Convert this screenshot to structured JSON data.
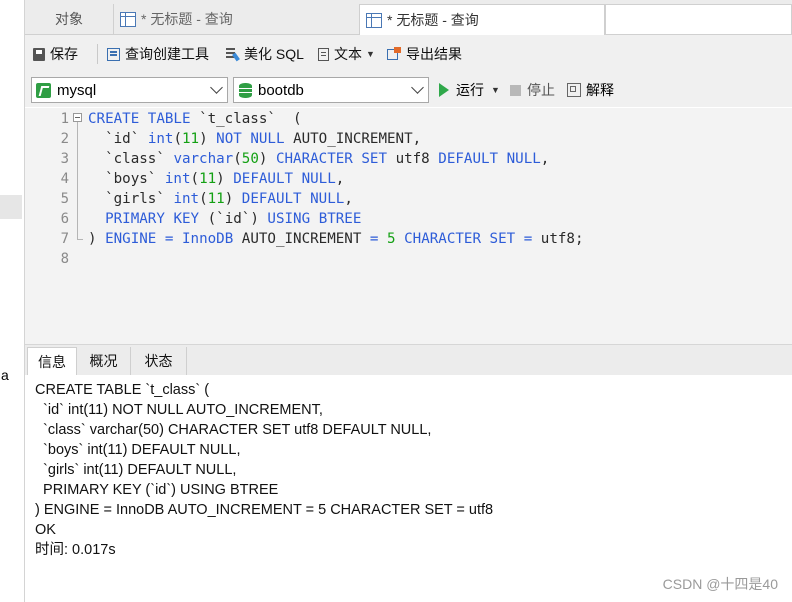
{
  "tabs": [
    {
      "label": "对象",
      "icon": "none"
    },
    {
      "label": "* 无标题 - 查询",
      "icon": "table-query-icon"
    },
    {
      "label": "* 无标题 - 查询",
      "icon": "table-query-icon",
      "active": true
    }
  ],
  "toolbar": {
    "save": "保存",
    "query_builder": "查询创建工具",
    "beautify": "美化 SQL",
    "text": "文本",
    "export": "导出结果"
  },
  "connection": {
    "server": "mysql",
    "database": "bootdb",
    "run": "运行",
    "stop": "停止",
    "explain": "解释"
  },
  "editor": {
    "line_numbers": [
      "1",
      "2",
      "3",
      "4",
      "5",
      "6",
      "7",
      "8"
    ]
  },
  "info_tabs": [
    "信息",
    "概况",
    "状态"
  ],
  "output": {
    "lines": [
      "CREATE TABLE `t_class` (",
      "  `id` int(11) NOT NULL AUTO_INCREMENT,",
      "  `class` varchar(50) CHARACTER SET utf8 DEFAULT NULL,",
      "  `boys` int(11) DEFAULT NULL,",
      "  `girls` int(11) DEFAULT NULL,",
      "  PRIMARY KEY (`id`) USING BTREE",
      ") ENGINE = InnoDB AUTO_INCREMENT = 5 CHARACTER SET = utf8",
      "OK",
      "时间: 0.017s"
    ]
  },
  "left_panel": {
    "fragment": "a"
  },
  "watermark": "CSDN @十四是40",
  "colors": {
    "keyword": "#2d5cd8",
    "number": "#13a013",
    "run_green": "#2fa84a"
  }
}
